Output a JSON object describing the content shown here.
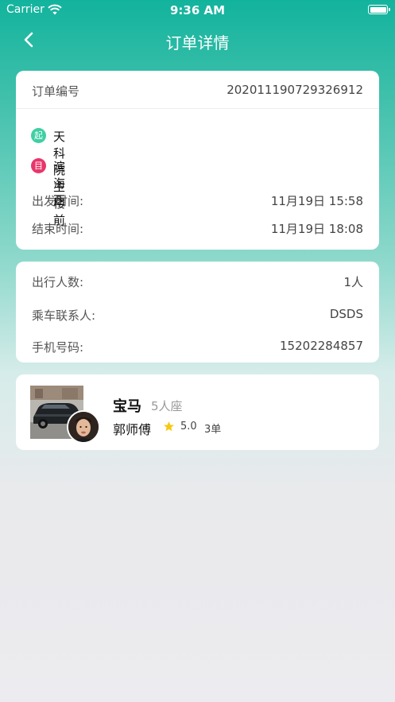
{
  "status_bar": {
    "carrier": "Carrier",
    "time": "9:36 AM"
  },
  "nav": {
    "title": "订单详情",
    "back_icon": "chevron-left-icon"
  },
  "order": {
    "number_label": "订单编号",
    "number_value": "20201119072932​6912",
    "origin_badge": "起",
    "origin": "天科院主楼前",
    "destination_badge": "目",
    "destination": "滨海西",
    "depart_label": "出发时间:",
    "depart_value": "11月19日 15:58",
    "end_label": "结束时间:",
    "end_value": "11月19日 18:08"
  },
  "passenger": {
    "count_label": "出行人数:",
    "count_value": "1人",
    "contact_label": "乘车联系人:",
    "contact_value": "DSDS",
    "phone_label": "手机号码:",
    "phone_value": "15202284857"
  },
  "car": {
    "brand": "宝马",
    "seats": "5人座",
    "driver": "郭师傅",
    "rating": "5.0",
    "orders": "3单"
  },
  "colors": {
    "accent": "#14b39e",
    "origin_badge": "#3fcfa3",
    "destination_badge": "#e8366a",
    "star": "#f7c815"
  }
}
